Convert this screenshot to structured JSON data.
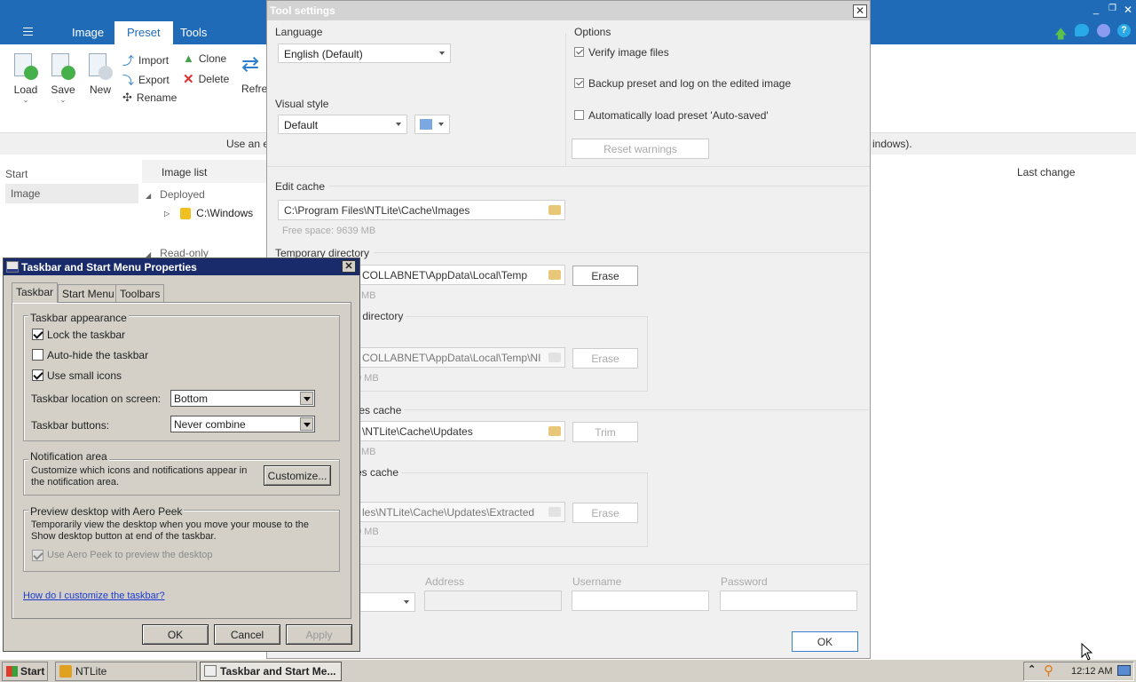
{
  "main": {
    "menu_icon": "hamburger-icon",
    "tabs": [
      "Image",
      "Preset",
      "Tools"
    ],
    "ribbon": {
      "load": "Load",
      "save": "Save",
      "new": "New",
      "import": "Import",
      "export": "Export",
      "rename": "Rename",
      "clone": "Clone",
      "delete": "Delete",
      "refresh": "Refre"
    },
    "info_left": "Use an e",
    "info_right": "indows).",
    "sidebar": {
      "header": "Start",
      "item": "Image"
    },
    "list": {
      "header": "Image list",
      "group_deployed": "Deployed",
      "item_windows": "C:\\Windows",
      "group_readonly": "Read-only",
      "col_last_change": "Last change"
    },
    "title_icons": [
      "up-arrow-icon",
      "twitter-icon",
      "discord-icon",
      "help-icon"
    ]
  },
  "tool_settings": {
    "title": "Tool settings",
    "language_label": "Language",
    "language_value": "English (Default)",
    "visual_style_label": "Visual style",
    "visual_style_value": "Default",
    "accent_color": "#7aa8e0",
    "options_label": "Options",
    "opt_verify": "Verify image files",
    "opt_backup": "Backup preset and log on the edited image",
    "opt_autoload": "Automatically load preset 'Auto-saved'",
    "reset_warnings": "Reset warnings",
    "edit_cache_label": "Edit cache",
    "edit_cache_path": "C:\\Program Files\\NTLite\\Cache\\Images",
    "free_space": "Free space: 9639 MB",
    "temp_dir_label": "Temporary directory",
    "temp_dir_path": "COLLABNET\\AppData\\Local\\Temp",
    "temp_sub": "MB",
    "erase": "Erase",
    "dir2_label": ") directory",
    "dir2_path": "COLLABNET\\AppData\\Local\\Temp\\NI",
    "dir2_sub": "9 MB",
    "updates_label": "tes cache",
    "updates_path": "\\NTLite\\Cache\\Updates",
    "updates_sub": "MB",
    "trim": "Trim",
    "extracted_label": "es cache",
    "extracted_path": "les\\NTLite\\Cache\\Updates\\Extracted",
    "extracted_sub": "9 MB",
    "address": "Address",
    "username": "Username",
    "password": "Password",
    "ok": "OK"
  },
  "taskbar_props": {
    "title": "Taskbar and Start Menu Properties",
    "tabs": [
      "Taskbar",
      "Start Menu",
      "Toolbars"
    ],
    "appearance_title": "Taskbar appearance",
    "lock": "Lock the taskbar",
    "autohide": "Auto-hide the taskbar",
    "small_icons": "Use small icons",
    "location_label": "Taskbar location on screen:",
    "location_value": "Bottom",
    "buttons_label": "Taskbar buttons:",
    "buttons_value": "Never combine",
    "notif_title": "Notification area",
    "notif_text": "Customize which icons and notifications appear in the notification area.",
    "customize": "Customize...",
    "peek_title": "Preview desktop with Aero Peek",
    "peek_text": "Temporarily view the desktop when you move your mouse to the Show desktop button at end of the taskbar.",
    "peek_cb": "Use Aero Peek to preview the desktop",
    "help_link": "How do I customize the taskbar?",
    "ok": "OK",
    "cancel": "Cancel",
    "apply": "Apply"
  },
  "taskbar": {
    "start": "Start",
    "app1": "NTLite",
    "app2": "Taskbar and Start Me...",
    "clock": "12:12 AM"
  }
}
